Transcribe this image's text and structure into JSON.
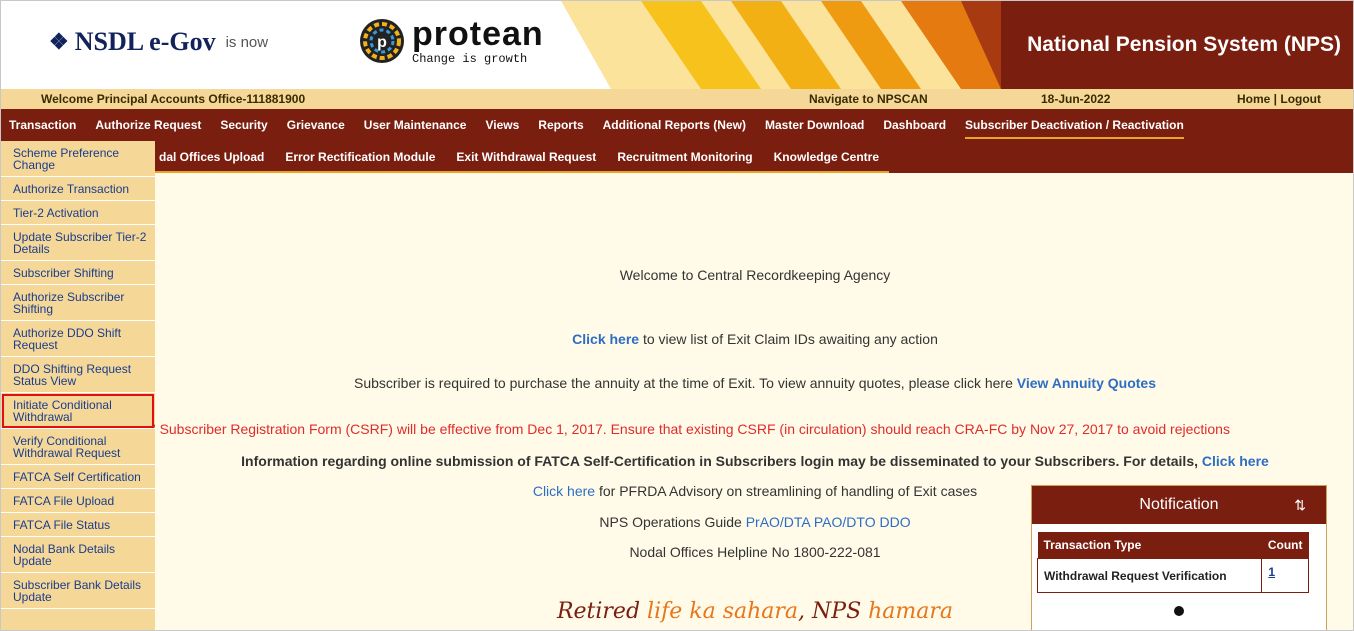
{
  "header": {
    "nsdl_logo": "NSDL e-Gov",
    "is_now": "is now",
    "protean_logo": "protean",
    "protean_tagline": "Change is growth",
    "title": "National Pension System (NPS)"
  },
  "welcome_bar": {
    "welcome": "Welcome Principal Accounts Office-111881900",
    "navigate": "Navigate to NPSCAN",
    "date": "18-Jun-2022",
    "home_logout": "Home | Logout"
  },
  "menu1": [
    "Transaction",
    "Authorize Request",
    "Security",
    "Grievance",
    "User Maintenance",
    "Views",
    "Reports",
    "Additional Reports (New)",
    "Master Download",
    "Dashboard",
    "Subscriber Deactivation / Reactivation"
  ],
  "menu2": [
    "dal Offices Upload",
    "Error Rectification Module",
    "Exit Withdrawal Request",
    "Recruitment Monitoring",
    "Knowledge Centre"
  ],
  "sidebar": [
    "Scheme Preference Change",
    "Authorize Transaction",
    "Tier-2 Activation",
    "Update Subscriber Tier-2 Details",
    "Subscriber Shifting",
    "Authorize Subscriber Shifting",
    "Authorize DDO Shift Request",
    "DDO Shifting Request Status View",
    "Initiate Conditional Withdrawal",
    "Verify Conditional Withdrawal Request",
    "FATCA Self Certification",
    "FATCA File Upload",
    "FATCA File Status",
    "Nodal Bank Details Update",
    "Subscriber Bank Details Update"
  ],
  "content": {
    "welcome": "Welcome to Central Recordkeeping Agency",
    "exit_link": "Click here",
    "exit_text": " to view list of Exit Claim IDs awaiting any action",
    "annuity_text": "Subscriber is required to purchase the annuity at the time of Exit. To view annuity quotes, please click here ",
    "annuity_link": "View Annuity Quotes",
    "csrf_text": "' Subscriber Registration Form (CSRF) will be effective from Dec 1, 2017. Ensure that existing CSRF (in circulation) should reach CRA-FC by Nov 27, 2017 to avoid rejections",
    "fatca_text": "Information regarding online submission of FATCA Self-Certification in Subscribers login may be disseminated to your Subscribers. For details, ",
    "fatca_link": "Click here",
    "pfrda_link": "Click here",
    "pfrda_text": " for PFRDA Advisory on streamlining of handling of Exit cases",
    "guide_text": "NPS Operations Guide ",
    "guide_link": "PrAO/DTA PAO/DTO DDO",
    "helpline": "Nodal Offices Helpline No 1800-222-081",
    "tagline_a": "Retired ",
    "tagline_b": "life ka sahara",
    "tagline_c": ", NPS ",
    "tagline_d": "hamara"
  },
  "notification": {
    "title": "Notification",
    "sort_icon": "⇅",
    "col_type": "Transaction Type",
    "col_count": "Count",
    "row_type": "Withdrawal Request Verification",
    "row_count": "1"
  },
  "colors": {
    "maroon": "#7a1e10",
    "sand": "#f5d898",
    "link": "#2d6ec4",
    "alert": "#e02b2b",
    "tagline_orange": "#e8761c"
  }
}
